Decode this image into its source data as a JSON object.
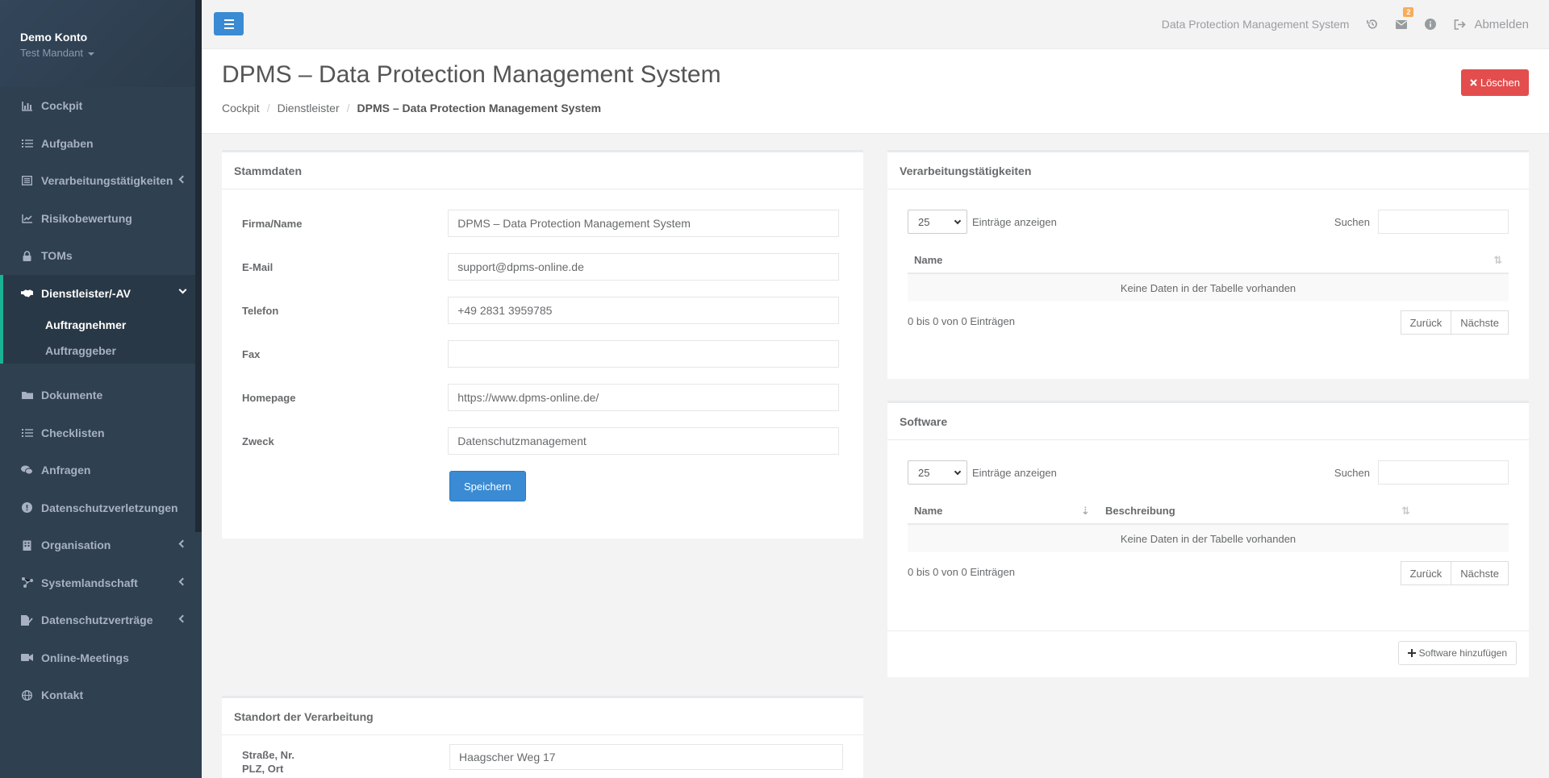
{
  "sidebar": {
    "profile_name": "Demo Konto",
    "profile_tenant": "Test Mandant",
    "items": [
      {
        "label": "Cockpit",
        "icon": "chart-icon"
      },
      {
        "label": "Aufgaben",
        "icon": "tasks-icon"
      },
      {
        "label": "Verarbeitungstätigkeiten",
        "icon": "list-alt-icon"
      },
      {
        "label": "Risikobewertung",
        "icon": "line-chart-icon"
      },
      {
        "label": "TOMs",
        "icon": "lock-icon"
      },
      {
        "label": "Dienstleister/-AV",
        "icon": "handshake-icon"
      },
      {
        "label": "Dokumente",
        "icon": "folder-icon"
      },
      {
        "label": "Checklisten",
        "icon": "list-icon"
      },
      {
        "label": "Anfragen",
        "icon": "comments-icon"
      },
      {
        "label": "Datenschutzverletzungen",
        "icon": "exclamation-icon"
      },
      {
        "label": "Organisation",
        "icon": "building-icon"
      },
      {
        "label": "Systemlandschaft",
        "icon": "network-icon"
      },
      {
        "label": "Datenschutzverträge",
        "icon": "file-signature-icon"
      },
      {
        "label": "Online-Meetings",
        "icon": "video-icon"
      },
      {
        "label": "Kontakt",
        "icon": "globe-icon"
      }
    ],
    "sub_items": [
      "Auftragnehmer",
      "Auftraggeber"
    ]
  },
  "topbar": {
    "app_name": "Data Protection Management System",
    "notifications_count": "2",
    "logout_label": "Abmelden"
  },
  "heading": {
    "title": "DPMS – Data Protection Management System",
    "breadcrumb": [
      "Cockpit",
      "Dienstleister",
      "DPMS – Data Protection Management System"
    ],
    "delete_label": "Löschen"
  },
  "stammdaten": {
    "title": "Stammdaten",
    "fields": [
      {
        "label": "Firma/Name",
        "value": "DPMS – Data Protection Management System"
      },
      {
        "label": "E-Mail",
        "value": "support@dpms-online.de"
      },
      {
        "label": "Telefon",
        "value": "+49 2831 3959785"
      },
      {
        "label": "Fax",
        "value": ""
      },
      {
        "label": "Homepage",
        "value": "https://www.dpms-online.de/"
      },
      {
        "label": "Zweck",
        "value": "Datenschutzmanagement"
      }
    ],
    "save_label": "Speichern"
  },
  "standort": {
    "title": "Standort der Verarbeitung",
    "street_label": "Straße, Nr.",
    "city_label": "PLZ, Ort",
    "street_value": "Haagscher Weg 17"
  },
  "verarbeitung": {
    "title": "Verarbeitungstätigkeiten",
    "page_length": "25",
    "length_label": "Einträge anzeigen",
    "search_label": "Suchen",
    "columns": [
      "Name"
    ],
    "empty_text": "Keine Daten in der Tabelle vorhanden",
    "info": "0 bis 0 von 0 Einträgen",
    "prev": "Zurück",
    "next": "Nächste"
  },
  "software": {
    "title": "Software",
    "page_length": "25",
    "length_label": "Einträge anzeigen",
    "search_label": "Suchen",
    "columns": [
      "Name",
      "Beschreibung"
    ],
    "empty_text": "Keine Daten in der Tabelle vorhanden",
    "info": "0 bis 0 von 0 Einträgen",
    "prev": "Zurück",
    "next": "Nächste",
    "add_label": "Software hinzufügen"
  }
}
